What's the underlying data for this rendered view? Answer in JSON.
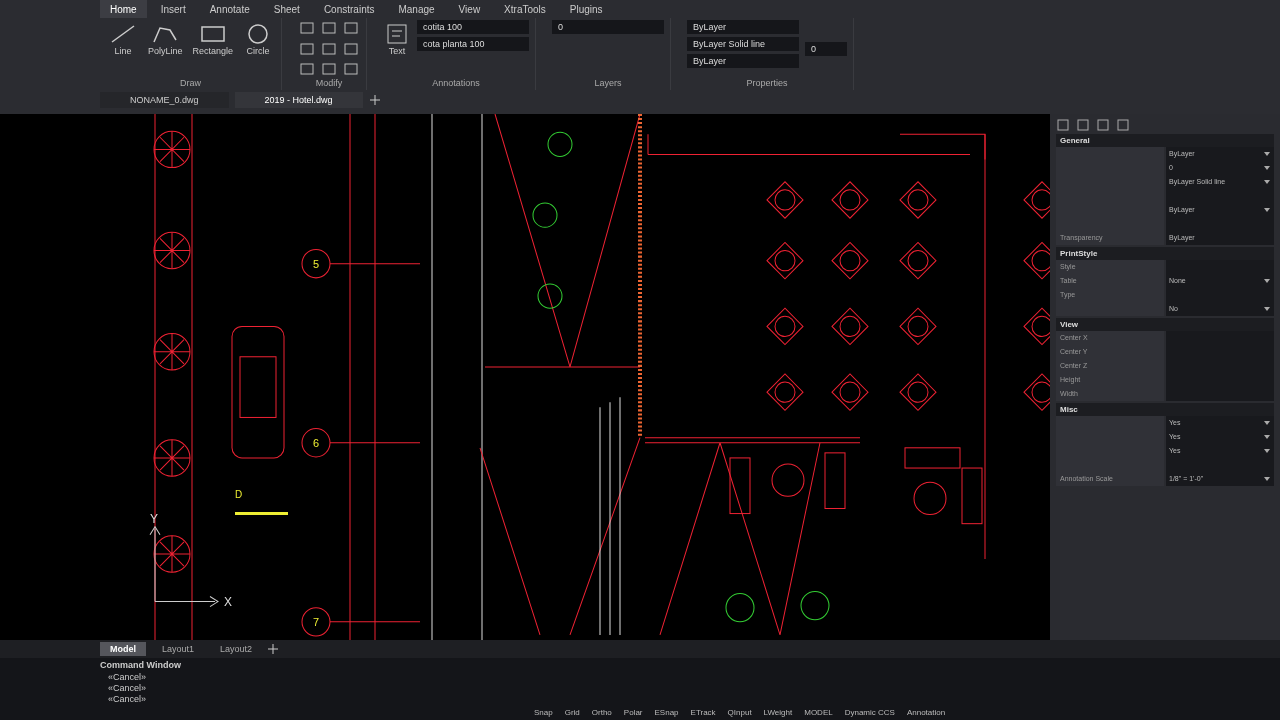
{
  "ribbon": {
    "tabs": [
      {
        "label": "Home",
        "selected": true
      },
      {
        "label": "Insert",
        "selected": false
      },
      {
        "label": "Annotate",
        "selected": false
      },
      {
        "label": "Sheet",
        "selected": false
      },
      {
        "label": "Constraints",
        "selected": false
      },
      {
        "label": "Manage",
        "selected": false
      },
      {
        "label": "View",
        "selected": false
      },
      {
        "label": "XtraTools",
        "selected": false
      },
      {
        "label": "Plugins",
        "selected": false
      }
    ],
    "draw_tools": [
      {
        "label": "Line",
        "kind": "line"
      },
      {
        "label": "PolyLine",
        "kind": "polyline"
      },
      {
        "label": "Rectangle",
        "kind": "rectangle"
      },
      {
        "label": "Circle",
        "kind": "circle"
      }
    ],
    "text_tool": "Text",
    "panels": [
      "Draw",
      "Modify",
      "Annotations",
      "Layers",
      "Properties"
    ],
    "text_styles": [
      "cotita 100",
      "cota planta 100"
    ],
    "layer": "0",
    "color_style": "ByLayer",
    "linetype": "ByLayer  Solid line",
    "lineweight": "ByLayer",
    "transparency": "0"
  },
  "file_tabs": [
    {
      "label": "NONAME_0.dwg",
      "selected": false
    },
    {
      "label": "2019 - Hotel.dwg",
      "selected": true
    }
  ],
  "drawing": {
    "grid_labels": [
      "5",
      "6",
      "7"
    ],
    "point_label": "D",
    "axis_labels": [
      "X",
      "Y"
    ]
  },
  "properties_panel": {
    "sections": [
      {
        "title": "General",
        "rows": [
          {
            "value": "ByLayer",
            "kind": "dropdown"
          },
          {
            "value": "0",
            "kind": "dropdown"
          },
          {
            "value": "ByLayer  Solid line",
            "kind": "dropdown"
          },
          {
            "kind": "field"
          },
          {
            "value": "ByLayer",
            "kind": "dropdown"
          },
          {
            "kind": "field"
          },
          {
            "label": "Transparency",
            "value": "ByLayer",
            "kind": "field"
          }
        ]
      },
      {
        "title": "PrintStyle",
        "rows": [
          {
            "label": "Style",
            "kind": "field"
          },
          {
            "label": "Table",
            "value": "None",
            "kind": "dropdown"
          },
          {
            "label": "Type",
            "kind": "field"
          },
          {
            "value": "No",
            "kind": "dropdown"
          }
        ]
      },
      {
        "title": "View",
        "rows": [
          {
            "label": "Center X",
            "kind": "field"
          },
          {
            "label": "Center Y",
            "kind": "field"
          },
          {
            "label": "Center Z",
            "kind": "field"
          },
          {
            "label": "Height",
            "kind": "field"
          },
          {
            "label": "Width",
            "kind": "field"
          }
        ]
      },
      {
        "title": "Misc",
        "rows": [
          {
            "value": "Yes",
            "kind": "dropdown"
          },
          {
            "value": "Yes",
            "kind": "dropdown"
          },
          {
            "value": "Yes",
            "kind": "dropdown"
          },
          {
            "kind": "field"
          },
          {
            "label": "Annotation Scale",
            "value": "1/8\" = 1'-0\"",
            "kind": "dropdown"
          }
        ]
      }
    ]
  },
  "layout_tabs": [
    {
      "label": "Model",
      "selected": true
    },
    {
      "label": "Layout1",
      "selected": false
    },
    {
      "label": "Layout2",
      "selected": false
    }
  ],
  "command_window": {
    "title": "Command Window",
    "history": [
      "«Cancel»",
      "«Cancel»",
      "«Cancel»"
    ]
  },
  "status_bar": [
    "Snap",
    "Grid",
    "Ortho",
    "Polar",
    "ESnap",
    "ETrack",
    "QInput",
    "LWeight",
    "MODEL",
    "Dynamic CCS",
    "Annotation"
  ]
}
